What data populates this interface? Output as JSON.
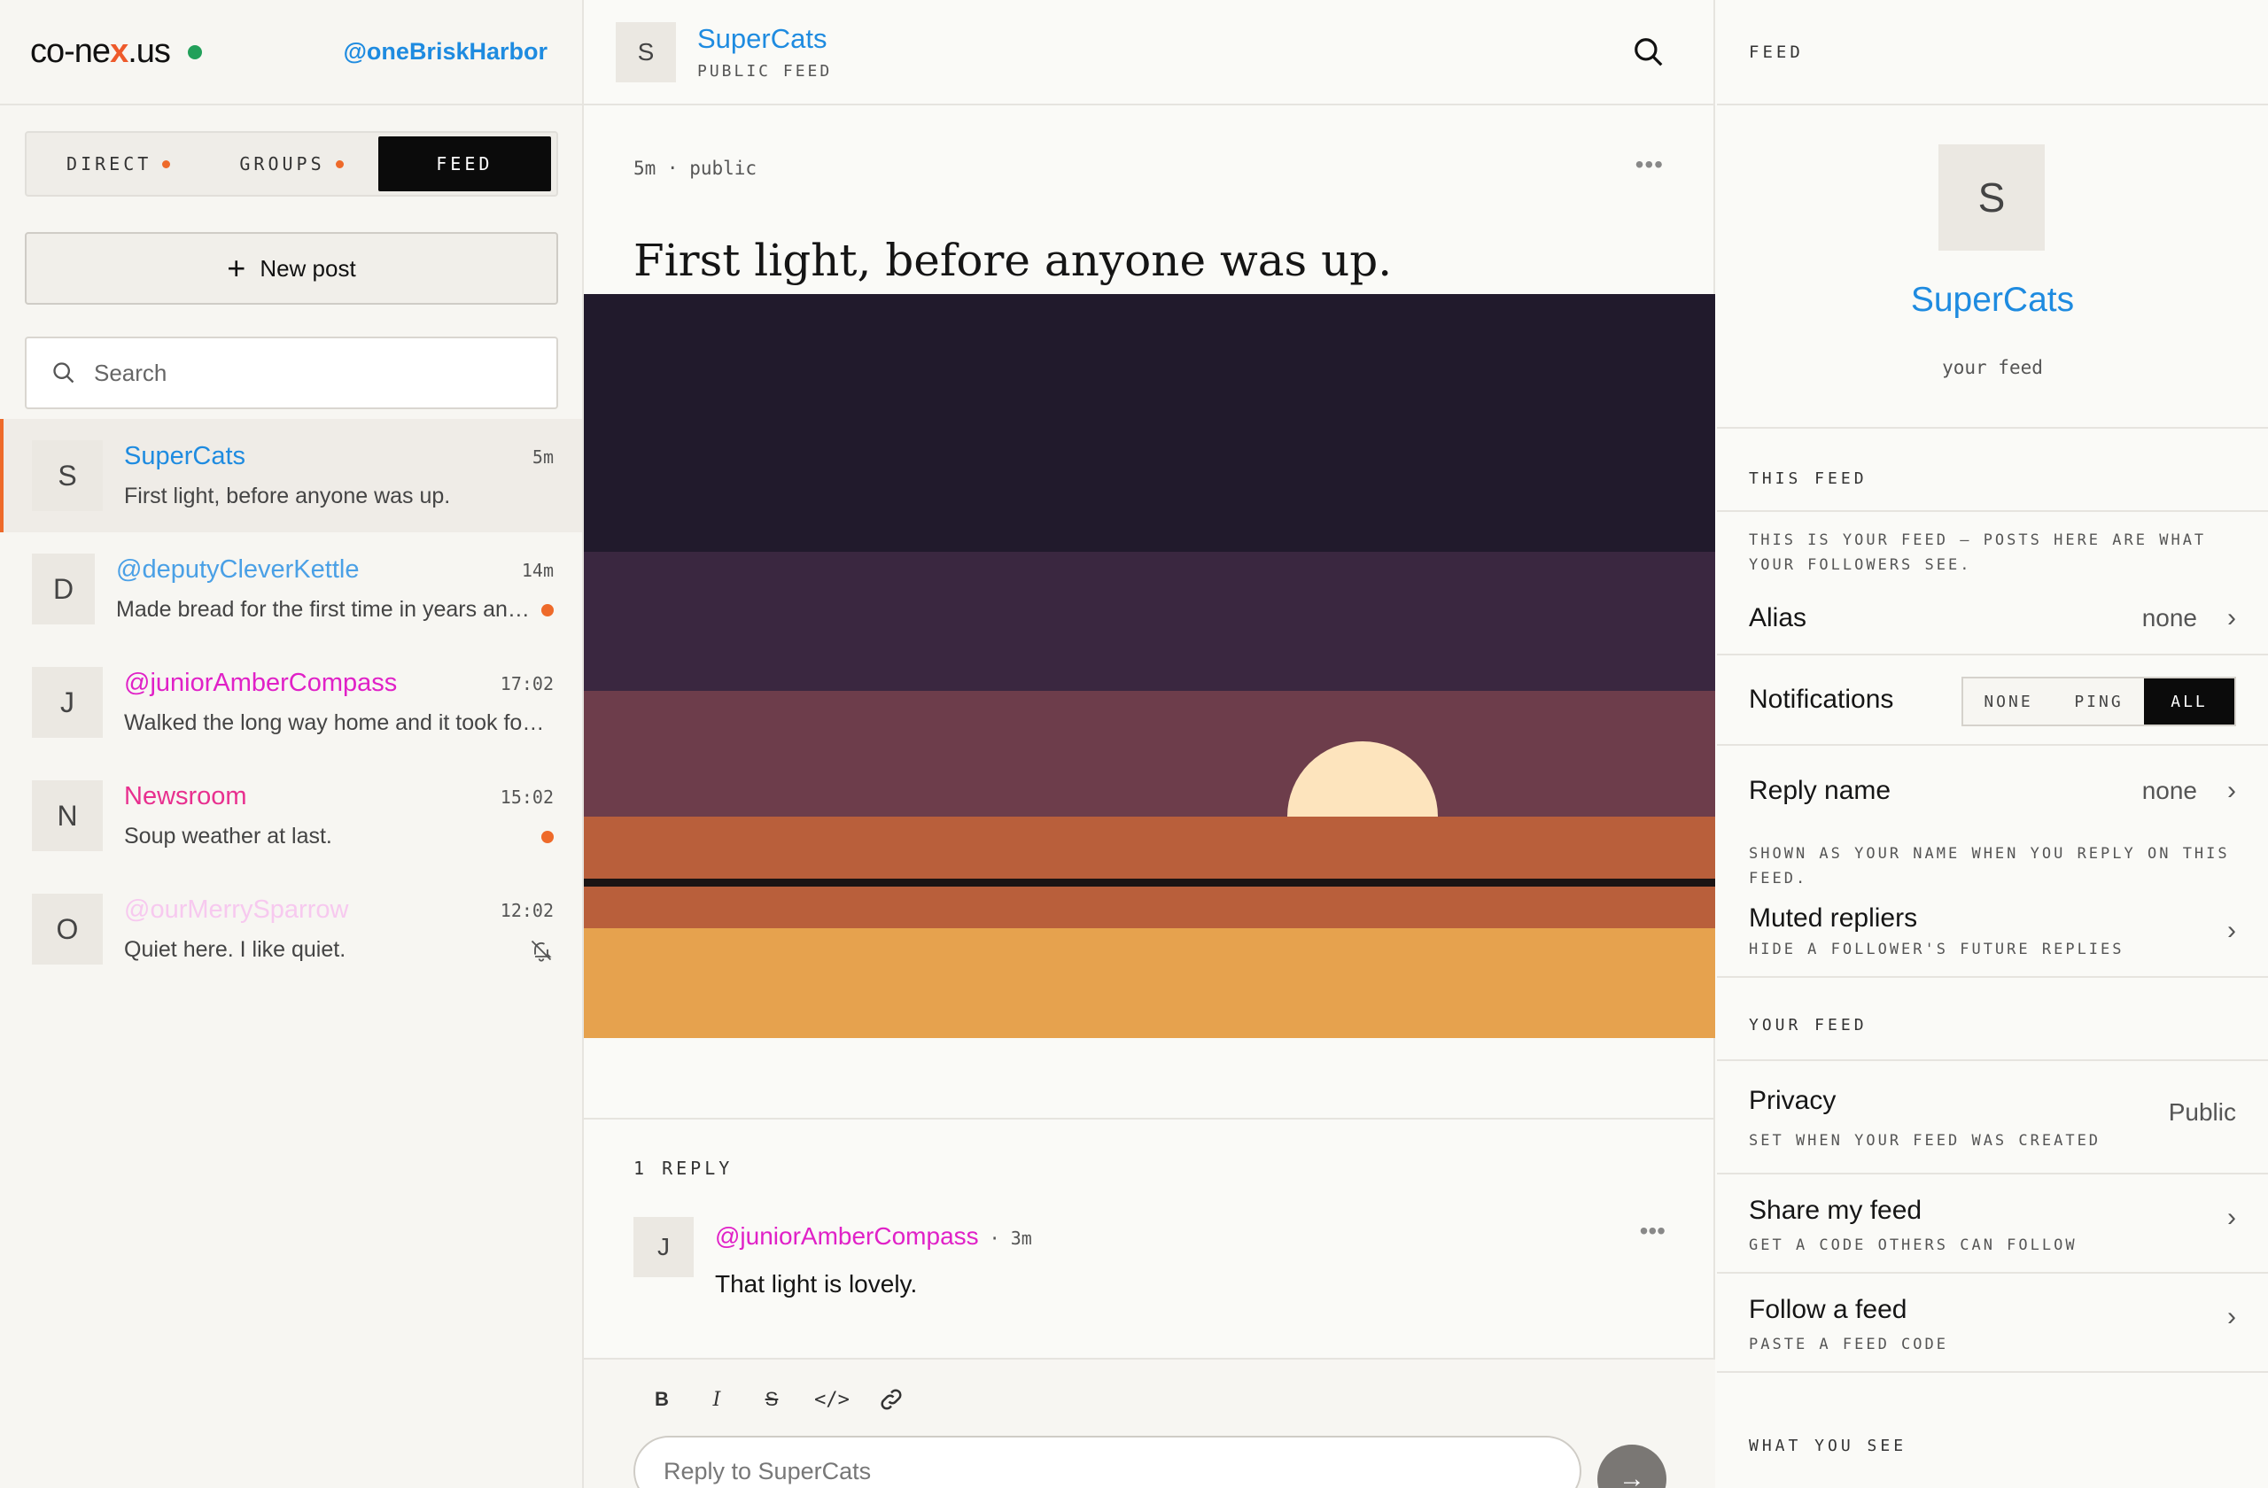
{
  "app": {
    "logo_left": "co-ne",
    "logo_x": "x",
    "logo_right": ".us",
    "user_handle": "@oneBriskHarbor",
    "status_color": "#22a05a",
    "accent_color": "#ee6a2a"
  },
  "sidebar": {
    "tabs": [
      {
        "label": "DIRECT",
        "unread": true
      },
      {
        "label": "GROUPS",
        "unread": true
      },
      {
        "label": "FEED",
        "active": true
      }
    ],
    "new_post_label": "New post",
    "search_placeholder": "Search",
    "conversations": [
      {
        "initial": "S",
        "name": "SuperCats",
        "name_color": "#1e8be0",
        "time": "5m",
        "preview": "First light, before anyone was up.",
        "active": true
      },
      {
        "initial": "D",
        "name": "@deputyCleverKettle",
        "name_color": "#4aa0e6",
        "time": "14m",
        "preview": "Made bread for the first time in years and it actually rose",
        "unread": true
      },
      {
        "initial": "J",
        "name": "@juniorAmberCompass",
        "name_color": "#e021c7",
        "time": "17:02",
        "preview": "Walked the long way home and it took forever but worth it"
      },
      {
        "initial": "N",
        "name": "Newsroom",
        "name_color": "#e8308f",
        "time": "15:02",
        "preview": "Soup weather at last.",
        "unread": true
      },
      {
        "initial": "O",
        "name": "@ourMerrySparrow",
        "name_color": "#f7c9ef",
        "time": "12:02",
        "preview": "Quiet here. I like quiet.",
        "muted": true
      }
    ]
  },
  "main": {
    "header": {
      "initial": "S",
      "title": "SuperCats",
      "subtitle": "PUBLIC FEED"
    },
    "post": {
      "meta": "5m · public",
      "title": "First light, before anyone was up."
    },
    "replies": {
      "count_label": "1 REPLY",
      "items": [
        {
          "initial": "J",
          "author": "@juniorAmberCompass",
          "time": "· 3m",
          "text": "That light is lovely."
        }
      ]
    },
    "composer": {
      "bold": "B",
      "italic": "I",
      "strike": "S",
      "code": "</>",
      "placeholder": "Reply to SuperCats"
    }
  },
  "right": {
    "header": "FEED",
    "profile": {
      "initial": "S",
      "name": "SuperCats",
      "subtitle": "your feed"
    },
    "this_feed_section": "THIS FEED",
    "this_feed_note": "THIS IS YOUR FEED — POSTS HERE ARE WHAT YOUR FOLLOWERS SEE.",
    "alias": {
      "label": "Alias",
      "value": "none"
    },
    "notifications": {
      "label": "Notifications",
      "options": [
        "NONE",
        "PING",
        "ALL"
      ],
      "selected": "ALL"
    },
    "reply_name": {
      "label": "Reply name",
      "value": "none",
      "note": "SHOWN AS YOUR NAME WHEN YOU REPLY ON THIS FEED."
    },
    "muted_repliers": {
      "label": "Muted repliers",
      "hint": "HIDE A FOLLOWER'S FUTURE REPLIES"
    },
    "your_feed_section": "YOUR FEED",
    "privacy": {
      "label": "Privacy",
      "value": "Public",
      "hint": "SET WHEN YOUR FEED WAS CREATED"
    },
    "share": {
      "label": "Share my feed",
      "hint": "GET A CODE OTHERS CAN FOLLOW"
    },
    "follow": {
      "label": "Follow a feed",
      "hint": "PASTE A FEED CODE"
    },
    "what_you_see_section": "WHAT YOU SEE"
  }
}
